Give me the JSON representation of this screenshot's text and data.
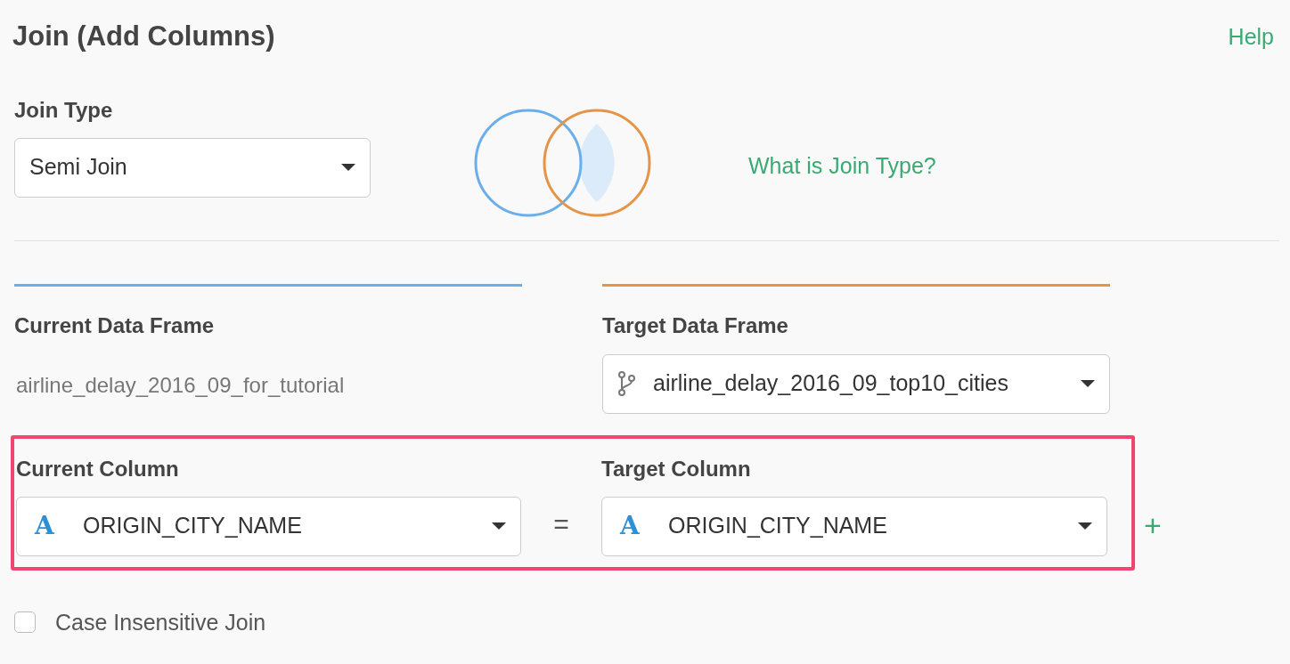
{
  "title": "Join (Add Columns)",
  "help_link": "Help",
  "join_type": {
    "label": "Join Type",
    "value": "Semi Join",
    "help_link": "What is Join Type?"
  },
  "current_frame": {
    "label": "Current Data Frame",
    "value": "airline_delay_2016_09_for_tutorial"
  },
  "target_frame": {
    "label": "Target Data Frame",
    "value": "airline_delay_2016_09_top10_cities"
  },
  "columns": {
    "highlighted": true,
    "current": {
      "label": "Current Column",
      "type_icon": "A",
      "value": "ORIGIN_CITY_NAME"
    },
    "equals": "=",
    "target": {
      "label": "Target Column",
      "type_icon": "A",
      "value": "ORIGIN_CITY_NAME"
    },
    "add": "+"
  },
  "case_insensitive": {
    "label": "Case Insensitive Join",
    "checked": false
  }
}
